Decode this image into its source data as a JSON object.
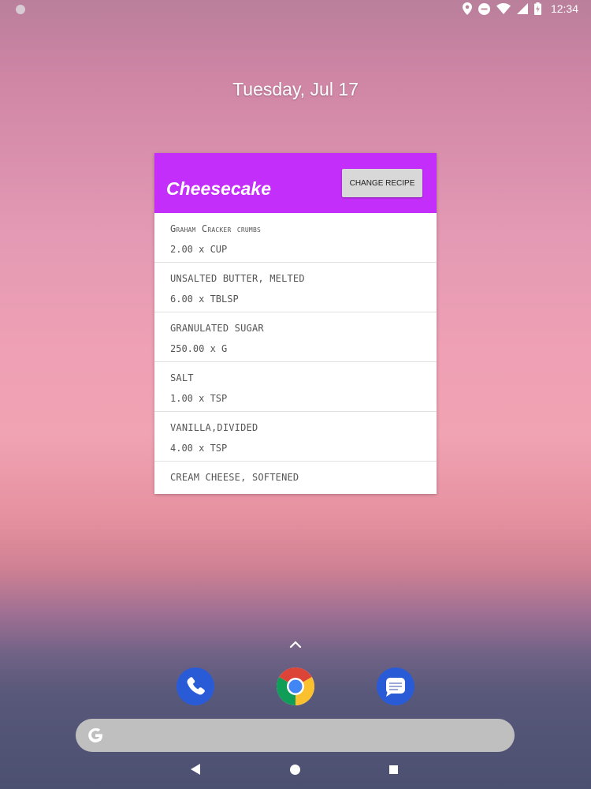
{
  "status_bar": {
    "time": "12:34",
    "icons": [
      "notification-dot-icon",
      "location-icon",
      "do-not-disturb-icon",
      "wifi-icon",
      "cell-signal-icon",
      "battery-charging-icon"
    ]
  },
  "date": "Tuesday, Jul 17",
  "widget": {
    "title": "Cheesecake",
    "change_button": "CHANGE RECIPE",
    "accent_color": "#c42efa",
    "ingredients": [
      {
        "name": "Graham Cracker crumbs",
        "qty": "2.00 x CUP"
      },
      {
        "name": "unsalted butter, melted",
        "qty": "6.00 x TBLSP"
      },
      {
        "name": "granulated sugar",
        "qty": "250.00 x G"
      },
      {
        "name": "salt",
        "qty": "1.00 x TSP"
      },
      {
        "name": "vanilla,divided",
        "qty": "4.00 x TSP"
      },
      {
        "name": "cream cheese, softened",
        "qty": ""
      }
    ]
  },
  "dock": {
    "apps": [
      "phone-app-icon",
      "chrome-app-icon",
      "messages-app-icon"
    ]
  },
  "search_bar": {
    "icon": "google-g-icon"
  },
  "nav_bar": {
    "buttons": [
      "back-icon",
      "home-icon",
      "recents-icon"
    ]
  }
}
